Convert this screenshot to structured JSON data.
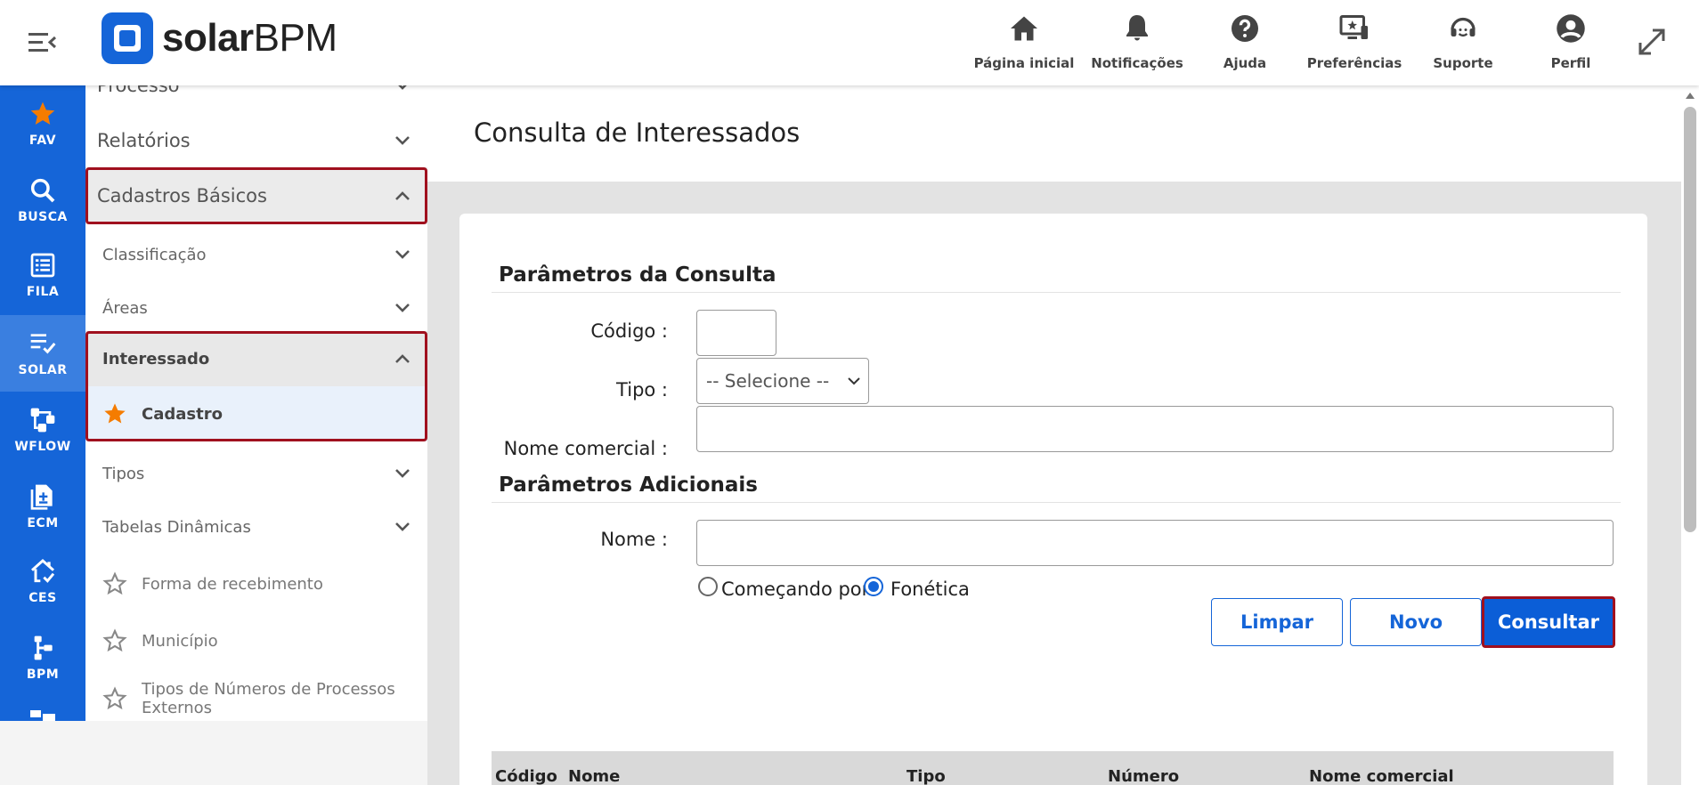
{
  "header": {
    "logo": {
      "bold": "solar",
      "regular": "BPM"
    },
    "nav": [
      {
        "label": "Página inicial",
        "icon": "home-icon"
      },
      {
        "label": "Notificações",
        "icon": "bell-icon"
      },
      {
        "label": "Ajuda",
        "icon": "help-icon"
      },
      {
        "label": "Preferências",
        "icon": "preferences-icon"
      },
      {
        "label": "Suporte",
        "icon": "support-icon"
      },
      {
        "label": "Perfil",
        "icon": "profile-icon"
      }
    ]
  },
  "rail": {
    "items": [
      {
        "label": "FAV",
        "icon": "star-icon"
      },
      {
        "label": "BUSCA",
        "icon": "search-icon"
      },
      {
        "label": "FILA",
        "icon": "list-icon"
      },
      {
        "label": "SOLAR",
        "icon": "checklist-icon",
        "active": true
      },
      {
        "label": "WFLOW",
        "icon": "workflow-icon"
      },
      {
        "label": "ECM",
        "icon": "document-icon"
      },
      {
        "label": "CES",
        "icon": "house-icon"
      },
      {
        "label": "BPM",
        "icon": "bpm-icon"
      }
    ]
  },
  "sidebar": {
    "partial_top": "Processo",
    "relatorios": "Relatórios",
    "cadastros_basicos": "Cadastros Básicos",
    "classificacao": "Classificação",
    "areas": "Áreas",
    "interessado": "Interessado",
    "cadastro": "Cadastro",
    "tipos": "Tipos",
    "tabelas_dinamicas": "Tabelas Dinâmicas",
    "forma_recebimento": "Forma de recebimento",
    "municipio": "Município",
    "tipos_numeros_line1": "Tipos de Números de Processos",
    "tipos_numeros_line2": "Externos"
  },
  "main": {
    "title": "Consulta de Interessados",
    "section1": "Parâmetros da Consulta",
    "codigo_label": "Código :",
    "codigo_value": "",
    "tipo_label": "Tipo :",
    "tipo_selected": "-- Selecione --",
    "nome_comercial_label": "Nome comercial :",
    "nome_comercial_value": "",
    "section2": "Parâmetros Adicionais",
    "nome_label": "Nome :",
    "nome_value": "",
    "radio_comecando": "Começando por",
    "radio_fonetica": "Fonética",
    "radio_selected": "Fonética",
    "btn_limpar": "Limpar",
    "btn_novo": "Novo",
    "btn_consultar": "Consultar",
    "table_headers": [
      "Código",
      "Nome",
      "Tipo",
      "Número",
      "Nome comercial"
    ]
  },
  "colors": {
    "brand": "#1565d8",
    "highlight": "#a0101e",
    "fav_star": "#f57c00"
  }
}
